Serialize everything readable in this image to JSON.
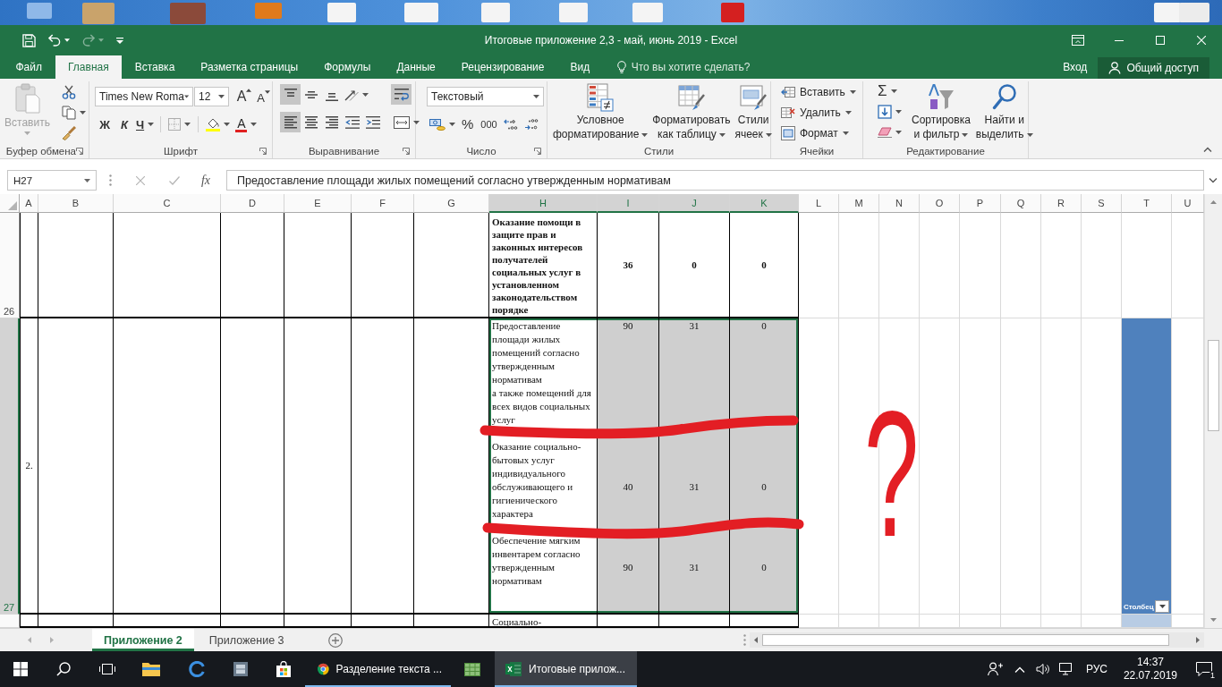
{
  "title_bar": {
    "title": "Итоговые приложение 2,3 - май, июнь 2019 - Excel",
    "undo": {
      "disabled": false
    },
    "redo": {
      "disabled": true
    }
  },
  "menu_tabs": [
    {
      "label": "Файл",
      "selected": false
    },
    {
      "label": "Главная",
      "selected": true
    },
    {
      "label": "Вставка",
      "selected": false
    },
    {
      "label": "Разметка страницы",
      "selected": false
    },
    {
      "label": "Формулы",
      "selected": false
    },
    {
      "label": "Данные",
      "selected": false
    },
    {
      "label": "Рецензирование",
      "selected": false
    },
    {
      "label": "Вид",
      "selected": false
    }
  ],
  "tell_me": {
    "placeholder": "Что вы хотите сделать?"
  },
  "account": {
    "sign_in": "Вход",
    "share": "Общий доступ"
  },
  "ribbon": {
    "clipboard": {
      "label": "Буфер обмена",
      "paste": {
        "label": "Вставить",
        "disabled": true
      }
    },
    "font": {
      "label": "Шрифт",
      "name": "Times New Roma",
      "size": "12",
      "grow": "A",
      "shrink": "A",
      "bold": "Ж",
      "italic": "К",
      "underline": "Ч",
      "font_color": "A"
    },
    "alignment": {
      "label": "Выравнивание",
      "vertical": [
        {
          "on": true
        },
        {
          "on": false
        },
        {
          "on": false
        }
      ],
      "horizontal": [
        {
          "on": true
        },
        {
          "on": false
        },
        {
          "on": false
        }
      ],
      "wrap_text": {
        "on": true
      }
    },
    "number": {
      "label": "Число",
      "format": "Текстовый",
      "percent": "%",
      "thousands": "000"
    },
    "styles": {
      "label": "Стили",
      "buttons": [
        {
          "label": "Условное\nформатирование"
        },
        {
          "label": "Форматировать\nкак таблицу"
        },
        {
          "label": "Стили\nячеек"
        }
      ]
    },
    "cells": {
      "label": "Ячейки",
      "buttons": [
        {
          "label": "Вставить"
        },
        {
          "label": "Удалить"
        },
        {
          "label": "Формат"
        }
      ]
    },
    "editing": {
      "label": "Редактирование",
      "autosum": "Σ",
      "sort": "Сортировка\nи фильтр",
      "find": "Найти и\nвыделить"
    }
  },
  "formula_bar": {
    "name_box": "H27",
    "function_label": "fx",
    "formula": "Предоставление площади жилых помещений согласно утвержденным нормативам"
  },
  "sheet": {
    "columns": [
      {
        "label": "A",
        "selected": false
      },
      {
        "label": "B",
        "selected": false
      },
      {
        "label": "C",
        "selected": false
      },
      {
        "label": "D",
        "selected": false
      },
      {
        "label": "E",
        "selected": false
      },
      {
        "label": "F",
        "selected": false
      },
      {
        "label": "G",
        "selected": false
      },
      {
        "label": "H",
        "selected": true
      },
      {
        "label": "I",
        "selected": true
      },
      {
        "label": "J",
        "selected": true
      },
      {
        "label": "K",
        "selected": true
      },
      {
        "label": "L",
        "selected": false
      },
      {
        "label": "M",
        "selected": false
      },
      {
        "label": "N",
        "selected": false
      },
      {
        "label": "O",
        "selected": false
      },
      {
        "label": "P",
        "selected": false
      },
      {
        "label": "Q",
        "selected": false
      },
      {
        "label": "R",
        "selected": false
      },
      {
        "label": "S",
        "selected": false
      },
      {
        "label": "T",
        "selected": false
      },
      {
        "label": "U",
        "selected": false
      }
    ],
    "rows": [
      {
        "number": "26",
        "selected": false,
        "cells": [
          {},
          {},
          {},
          {},
          {},
          {},
          {},
          {
            "kind": "text",
            "text": "Оказание помощи в защите прав и законных интересов получателей социальных услуг в установленном законодательством порядке",
            "bold": true,
            "selected": false
          },
          {
            "kind": "number",
            "text": "36",
            "bold": true,
            "selected": false
          },
          {
            "kind": "number",
            "text": "0",
            "bold": true,
            "selected": false
          },
          {
            "kind": "number",
            "text": "0",
            "bold": true,
            "selected": false
          },
          {},
          {},
          {},
          {},
          {},
          {},
          {},
          {},
          {},
          {}
        ]
      },
      {
        "number": "27",
        "selected": true,
        "cells": [
          {
            "kind": "number",
            "text": "2.",
            "selected": false
          },
          {},
          {},
          {},
          {},
          {},
          {},
          {
            "kind": "text",
            "entries": [
              "Предоставление площади жилых помещений согласно утвержденным нормативам\nа также помещений для всех видов социальных услуг",
              "Оказание социально-бытовых услуг индивидуального обслуживающего и гигиенического характера",
              "Обеспечение мягким инвентарем согласно утвержденным нормативам"
            ],
            "selected": true,
            "active": true
          },
          {
            "kind": "number",
            "entries": [
              "90",
              "40",
              "90"
            ],
            "selected": true
          },
          {
            "kind": "number",
            "entries": [
              "31",
              "31",
              "31"
            ],
            "selected": true
          },
          {
            "kind": "number",
            "entries": [
              "0",
              "0",
              "0"
            ],
            "selected": true
          },
          {},
          {},
          {},
          {},
          {},
          {},
          {},
          {},
          {
            "kind": "table-header",
            "text": "Столбец",
            "selected": false
          },
          {}
        ]
      },
      {
        "selected": false,
        "cells": [
          {},
          {},
          {},
          {},
          {},
          {},
          {},
          {
            "kind": "text",
            "text": "Социально-",
            "selected": false
          },
          {},
          {},
          {},
          {},
          {},
          {},
          {},
          {},
          {},
          {},
          {},
          {
            "kind": "table-body",
            "selected": false
          },
          {}
        ]
      }
    ]
  },
  "sheet_tabs": [
    {
      "label": "Приложение 2",
      "selected": true
    },
    {
      "label": "Приложение 3",
      "selected": false
    }
  ],
  "annotation": {
    "mark": "?"
  },
  "taskbar": {
    "windows": [
      {
        "label": "Разделение текста ...",
        "selected": false
      },
      {
        "label": "Итоговые прилож...",
        "selected": true
      }
    ],
    "language": "РУС",
    "time": "14:37",
    "date": "22.07.2019",
    "notifications": "1"
  }
}
